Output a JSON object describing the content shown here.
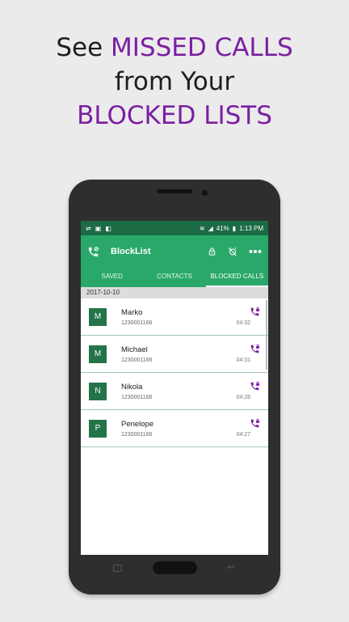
{
  "promo": {
    "line1_prefix": "See ",
    "line1_highlight": "MISSED CALLS",
    "line2": "from Your",
    "line3_highlight": "BLOCKED LISTS"
  },
  "colors": {
    "accent_purple": "#7b1fa2",
    "toolbar_green": "#2aa86a",
    "status_green": "#1b6b45",
    "avatar_green": "#237449"
  },
  "status_bar": {
    "battery": "41%",
    "time": "1:13 PM"
  },
  "app": {
    "title": "BlockList"
  },
  "toolbar_icons": [
    "phone-blocked-icon",
    "lock-icon",
    "alarm-off-icon",
    "more-icon"
  ],
  "tabs": [
    {
      "label": "SAVED"
    },
    {
      "label": "CONTACTS"
    },
    {
      "label": "BLOCKED CALLS",
      "active": true
    }
  ],
  "date_header": "2017-10-10",
  "calls": [
    {
      "initial": "M",
      "name": "Marko",
      "number": "1230001166",
      "time": "04:32"
    },
    {
      "initial": "M",
      "name": "Michael",
      "number": "1230001166",
      "time": "04:31"
    },
    {
      "initial": "N",
      "name": "Nikola",
      "number": "1230001166",
      "time": "04:28"
    },
    {
      "initial": "P",
      "name": "Penelope",
      "number": "1230001166",
      "time": "04:27"
    }
  ],
  "nav_icons": [
    "recent-apps-icon",
    "home-button",
    "back-icon"
  ]
}
